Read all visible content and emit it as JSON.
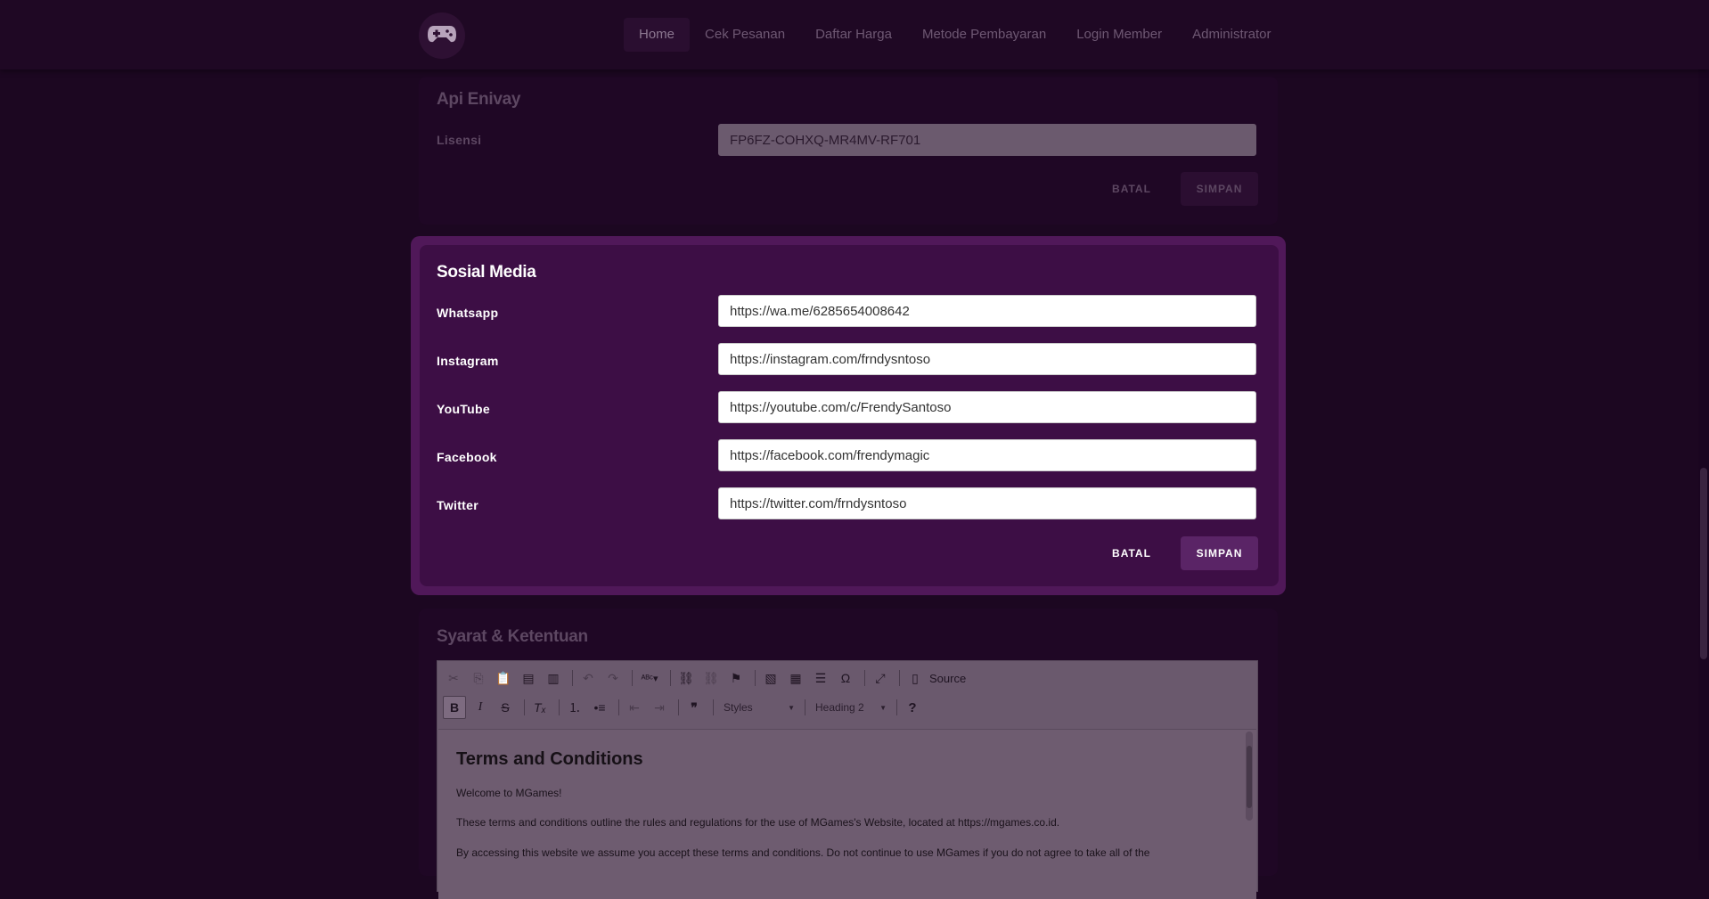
{
  "nav": {
    "logo_icon": "gamepad-icon",
    "links": [
      "Home",
      "Cek Pesanan",
      "Daftar Harga",
      "Metode Pembayaran",
      "Login Member",
      "Administrator"
    ],
    "active": "Home"
  },
  "api": {
    "title": "Api Enivay",
    "license_label": "Lisensi",
    "license_value": "FP6FZ-COHXQ-MR4MV-RF701",
    "cancel": "BATAL",
    "save": "SIMPAN"
  },
  "social": {
    "title": "Sosial Media",
    "fields": [
      {
        "label": "Whatsapp",
        "value": "https://wa.me/6285654008642"
      },
      {
        "label": "Instagram",
        "value": "https://instagram.com/frndysntoso"
      },
      {
        "label": "YouTube",
        "value": "https://youtube.com/c/FrendySantoso"
      },
      {
        "label": "Facebook",
        "value": "https://facebook.com/frendymagic"
      },
      {
        "label": "Twitter",
        "value": "https://twitter.com/frndysntoso"
      }
    ],
    "cancel": "BATAL",
    "save": "SIMPAN"
  },
  "terms": {
    "title": "Syarat & Ketentuan",
    "toolbar": {
      "source_label": "Source",
      "styles_label": "Styles",
      "format_label": "Heading 2",
      "help_label": "?"
    },
    "content": {
      "heading": "Terms and Conditions",
      "p1": "Welcome to MGames!",
      "p2": "These terms and conditions outline the rules and regulations for the use of MGames's Website, located at https://mgames.co.id.",
      "p3": "By accessing this website we assume you accept these terms and conditions. Do not continue to use MGames if you do not agree to take all of the"
    }
  },
  "colors": {
    "background": "#1c0721",
    "active_card": "#3d0e45",
    "active_border": "#501859",
    "primary_button": "#5a2466"
  }
}
